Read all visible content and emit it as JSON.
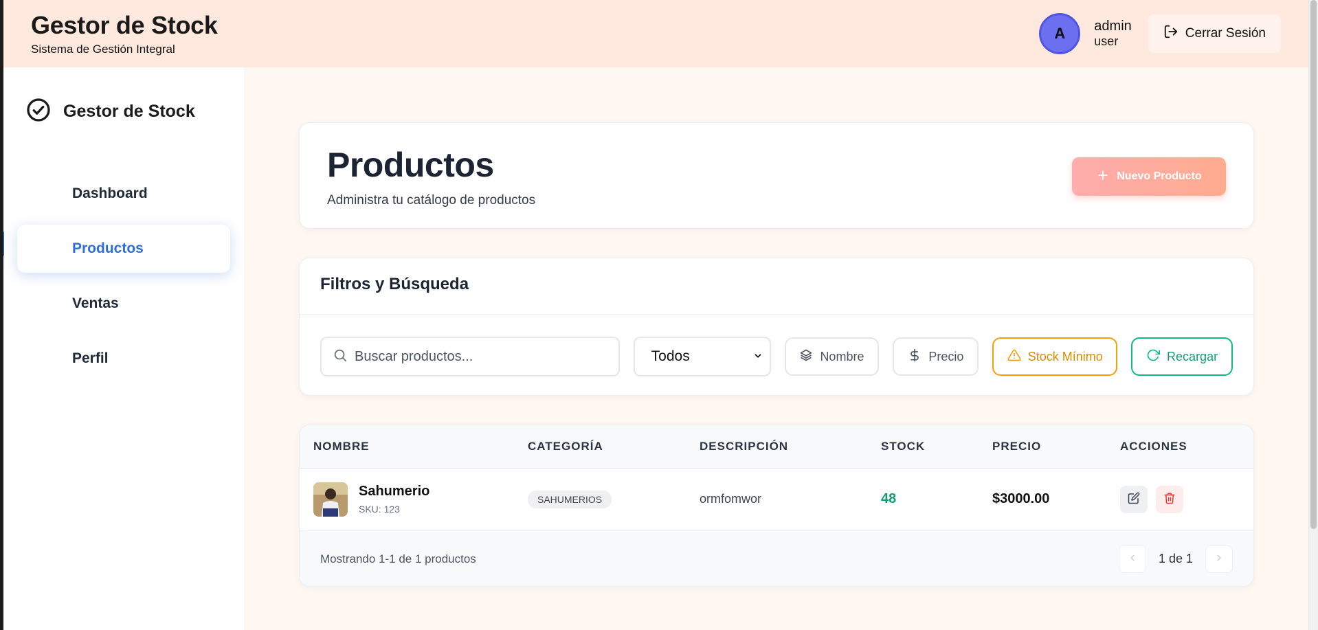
{
  "header": {
    "title": "Gestor de Stock",
    "subtitle": "Sistema de Gestión Integral",
    "user": {
      "initial": "A",
      "name": "admin",
      "role": "user"
    },
    "logout_label": "Cerrar Sesión"
  },
  "sidebar": {
    "brand": "Gestor de Stock",
    "items": [
      {
        "label": "Dashboard",
        "active": false
      },
      {
        "label": "Productos",
        "active": true
      },
      {
        "label": "Ventas",
        "active": false
      },
      {
        "label": "Perfil",
        "active": false
      }
    ]
  },
  "page": {
    "title": "Productos",
    "subtitle": "Administra tu catálogo de productos",
    "new_button": "Nuevo Producto"
  },
  "filters": {
    "heading": "Filtros y Búsqueda",
    "search_placeholder": "Buscar productos...",
    "category_selected": "Todos",
    "sort_name": "Nombre",
    "sort_price": "Precio",
    "stock_min": "Stock Mínimo",
    "reload": "Recargar"
  },
  "table": {
    "columns": [
      "NOMBRE",
      "CATEGORÍA",
      "DESCRIPCIÓN",
      "STOCK",
      "PRECIO",
      "ACCIONES"
    ],
    "rows": [
      {
        "name": "Sahumerio",
        "sku": "SKU: 123",
        "category": "SAHUMERIOS",
        "description": "ormfomwor",
        "stock": "48",
        "price": "$3000.00"
      }
    ],
    "footer_text": "Mostrando 1-1 de 1 productos",
    "page_indicator": "1 de 1"
  },
  "colors": {
    "header_bg": "#ffe8dd",
    "accent_blue": "#2f6fd8",
    "stock_green": "#0f9f6e",
    "warning_orange": "#f59e0b",
    "danger_red": "#e53935"
  }
}
